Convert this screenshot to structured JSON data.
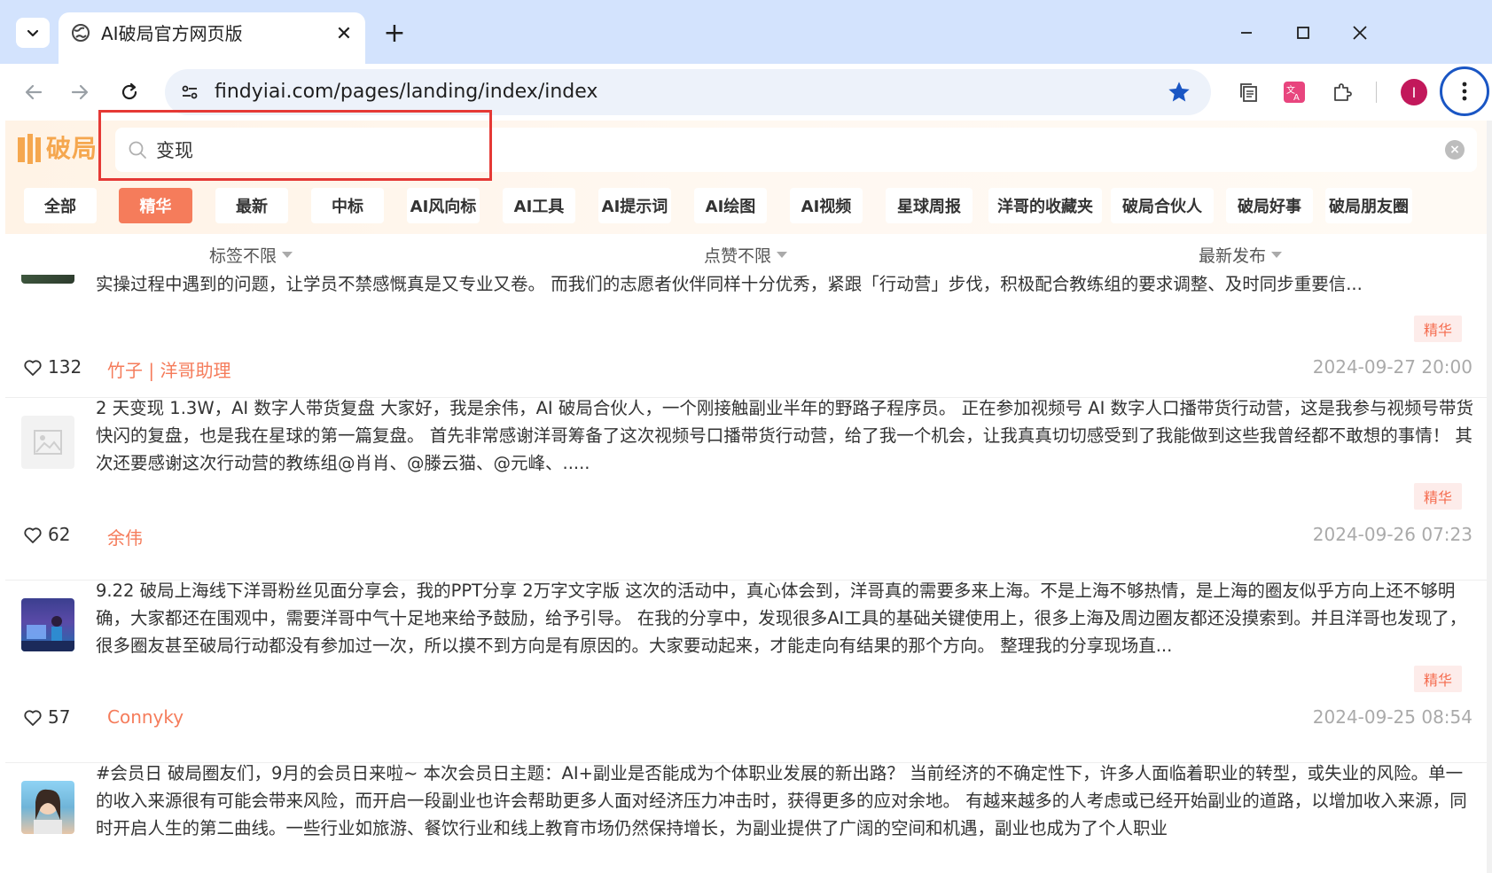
{
  "browser": {
    "tab_title": "AI破局官方网页版",
    "tab_close": "✕",
    "new_tab": "+",
    "url": "findyiai.com/pages/landing/index/index",
    "profile_initial": "I"
  },
  "header": {
    "logo_text": "破局",
    "search_value": "变现",
    "search_clear": "×"
  },
  "categories": [
    "全部",
    "精华",
    "最新",
    "中标",
    "AI风向标",
    "AI工具",
    "AI提示词",
    "AI绘图",
    "AI视频",
    "星球周报",
    "洋哥的收藏夹",
    "破局合伙人",
    "破局好事",
    "破局朋友圈"
  ],
  "active_category": "精华",
  "filters": {
    "tag": "标签不限",
    "likes": "点赞不限",
    "sort": "最新发布"
  },
  "posts": [
    {
      "text": "实操过程中遇到的问题，让学员不禁感慨真是又专业又卷。 而我们的志愿者伙伴同样十分优秀，紧跟「行动营」步伐，积极配合教练组的要求调整、及时同步重要信...",
      "tag": "精华",
      "likes": "132",
      "author": "竹子 | 洋哥助理",
      "date": "2024-09-27 20:00"
    },
    {
      "text": "2 天变现 1.3W，AI 数字人带货复盘 大家好，我是余伟，AI 破局合伙人，一个刚接触副业半年的野路子程序员。 正在参加视频号 AI 数字人口播带货行动营，这是我参与视频号带货快闪的复盘，也是我在星球的第一篇复盘。 首先非常感谢洋哥筹备了这次视频号口播带货行动营，给了我一个机会，让我真真切切感受到了我能做到这些我曾经都不敢想的事情！ 其次还要感谢这次行动营的教练组@肖肖、@滕云猫、@元峰、.....",
      "tag": "精华",
      "likes": "62",
      "author": "余伟",
      "date": "2024-09-26 07:23"
    },
    {
      "text": "9.22 破局上海线下洋哥粉丝见面分享会，我的PPT分享 2万字文字版 这次的活动中，真心体会到，洋哥真的需要多来上海。不是上海不够热情，是上海的圈友似乎方向上还不够明确，大家都还在围观中，需要洋哥中气十足地来给予鼓励，给予引导。 在我的分享中，发现很多AI工具的基础关键使用上，很多上海及周边圈友都还没摸索到。并且洋哥也发现了，很多圈友甚至破局行动都没有参加过一次，所以摸不到方向是有原因的。大家要动起来，才能走向有结果的那个方向。 整理我的分享现场直...",
      "tag": "精华",
      "likes": "57",
      "author": "Connyky",
      "date": "2024-09-25 08:54"
    },
    {
      "text": "#会员日 破局圈友们，9月的会员日来啦~ 本次会员日主题：AI+副业是否能成为个体职业发展的新出路？ 当前经济的不确定性下，许多人面临着职业的转型，或失业的风险。单一的收入来源很有可能会带来风险，而开启一段副业也许会帮助更多人面对经济压力冲击时，获得更多的应对余地。 有越来越多的人考虑或已经开始副业的道路，以增加收入来源，同时开启人生的第二曲线。一些行业如旅游、餐饮行业和线上教育市场仍然保持增长，为副业提供了广阔的空间和机遇，副业也成为了个人职业"
    }
  ]
}
